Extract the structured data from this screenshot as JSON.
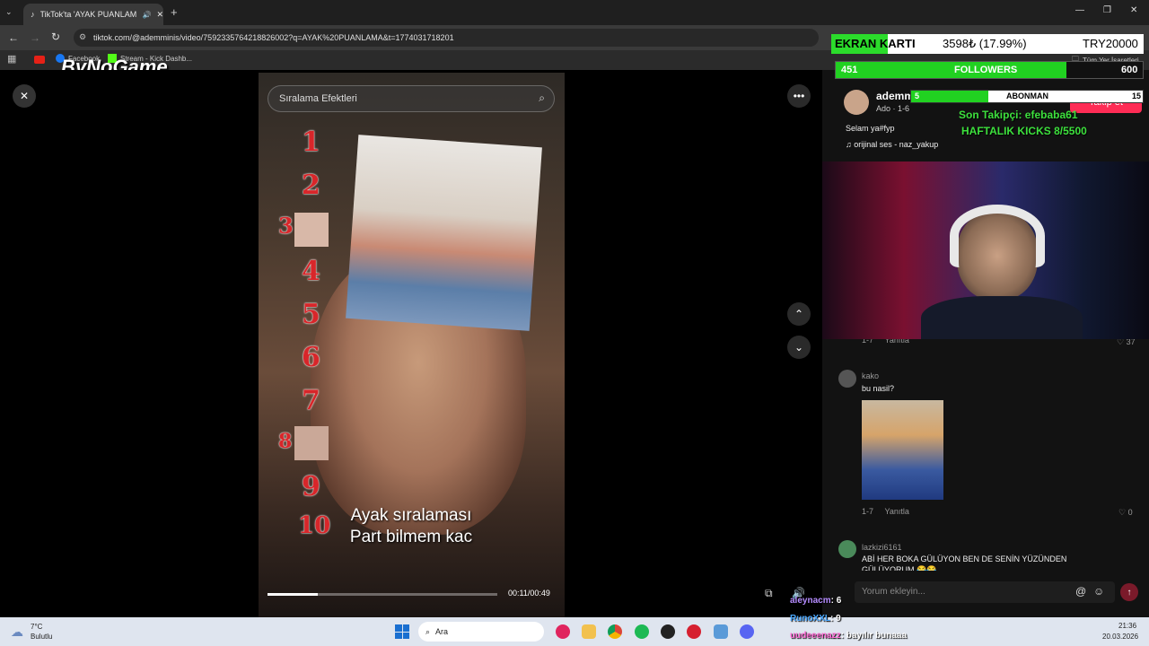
{
  "browser": {
    "tab_title": "TikTok'ta 'AYAK PUANLAMA...",
    "url": "tiktok.com/@ademminis/video/7592335764218826002?q=AYAK%20PUANLAMA&t=1774031718201",
    "bookmarks": [
      "Facebook",
      "Stream - Kick Dashb...",
      "Tüm Yer İşaretleri"
    ],
    "window_controls": [
      "—",
      "❐",
      "✕"
    ]
  },
  "watermark": "ByNoGame",
  "video": {
    "search_placeholder": "Sıralama Efektleri",
    "ranks": [
      "1",
      "2",
      "3",
      "4",
      "5",
      "6",
      "7",
      "8",
      "9",
      "10"
    ],
    "caption_line1": "Ayak sıralaması",
    "caption_line2": "Part bilmem kac",
    "time": "00:11/00:49",
    "progress": 0.22
  },
  "post": {
    "username": "ademm",
    "meta": "Ado · 1-6",
    "follow_label": "Takip et",
    "description": "Selam ya#fyp",
    "sound": "orijinal ses - naz_yakup"
  },
  "stream_overlay": {
    "goal_label": "EKRAN KARTI",
    "goal_progress": "3598₺ (17.99%)",
    "goal_target": "TRY20000",
    "goal_fraction": 0.18,
    "followers_current": "451",
    "followers_label": "FOLLOWERS",
    "followers_target": "600",
    "followers_fraction": 0.75,
    "sub_label": "ABONMAN",
    "sub_current": "5",
    "sub_target": "15",
    "last_follower": "Son Takipçi: efebaba61",
    "weekly_kicks": "HAFTALIK KICKS 8/5500"
  },
  "comments": [
    {
      "meta": "1-7",
      "reply": "Yanıtla",
      "likes": "37"
    },
    {
      "user": "kako",
      "text": "bu nasil?",
      "meta": "1-7",
      "reply": "Yanıtla",
      "likes": "0"
    },
    {
      "user": "lazkizi6161",
      "text": "ABİ HER BOKA GÜLÜYON BEN DE SENİN YÜZÜNDEN",
      "text2": "GÜLÜYORUM 😂😂"
    }
  ],
  "comment_input_placeholder": "Yorum ekleyin...",
  "chat": [
    {
      "user": "aleynacm",
      "text": ": 6",
      "color": "#b58cff"
    },
    {
      "user": "RunoXXL",
      "text": ": 9",
      "color": "#4aa8ff"
    },
    {
      "user": "uudeeenazz",
      "text": ": bayılır bunaaa",
      "color": "#ff6ad5"
    }
  ],
  "taskbar": {
    "weather_temp": "7°C",
    "weather_desc": "Bulutlu",
    "search_label": "Ara",
    "time": "21:36",
    "date": "20.03.2026"
  }
}
